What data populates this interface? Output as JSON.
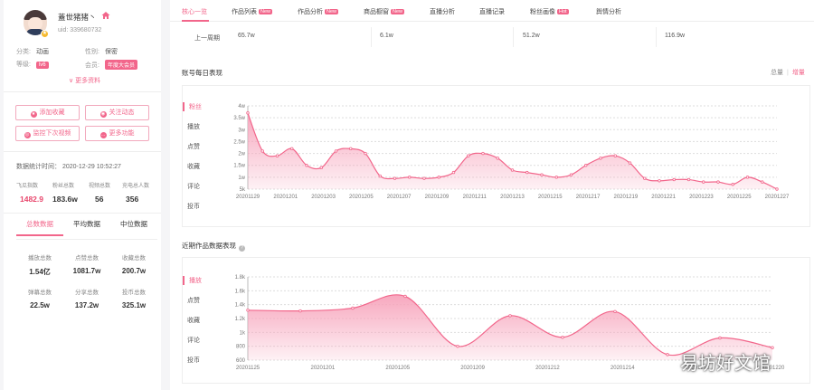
{
  "profile": {
    "name": "蓋世猪猪丶",
    "uid": "uid: 339680732",
    "category_label": "分类:",
    "category": "动画",
    "gender_label": "性别:",
    "gender": "保密",
    "level_label": "等级:",
    "level": "lv6",
    "member_label": "会员:",
    "member": "年度大会员",
    "vip_badge": "★",
    "more": "更多资料"
  },
  "actions": [
    {
      "label": "添加收藏",
      "icon": "★"
    },
    {
      "label": "关注动态",
      "icon": "◉"
    },
    {
      "label": "监控下次视频",
      "icon": "◎"
    },
    {
      "label": "更多功能",
      "icon": "…"
    }
  ],
  "stats_time": "数据统计时间：  2020-12-29 10:52:27",
  "summary": [
    {
      "label": "飞瓜指数",
      "value": "1482.9"
    },
    {
      "label": "粉丝总数",
      "value": "183.6w"
    },
    {
      "label": "视频总数",
      "value": "56"
    },
    {
      "label": "充电总人数",
      "value": "356"
    }
  ],
  "left_tabs": [
    "总数数据",
    "平均数据",
    "中位数据"
  ],
  "totals": [
    {
      "label": "播放总数",
      "value": "1.54亿"
    },
    {
      "label": "点赞总数",
      "value": "1081.7w"
    },
    {
      "label": "收藏总数",
      "value": "200.7w"
    },
    {
      "label": "弹幕总数",
      "value": "22.5w"
    },
    {
      "label": "分享总数",
      "value": "137.2w"
    },
    {
      "label": "投币总数",
      "value": "325.1w"
    }
  ],
  "nav": [
    {
      "label": "核心一览"
    },
    {
      "label": "作品列表",
      "badge": "New"
    },
    {
      "label": "作品分析",
      "badge": "New"
    },
    {
      "label": "商品橱窗",
      "badge": "New"
    },
    {
      "label": "直播分析"
    },
    {
      "label": "直播记录"
    },
    {
      "label": "粉丝画像",
      "badge": "Hot"
    },
    {
      "label": "舆情分析"
    }
  ],
  "prev_period": {
    "label": "上一周期",
    "values": [
      "65.7w",
      "6.1w",
      "51.2w",
      "116.9w"
    ]
  },
  "daily": {
    "title": "账号每日表现",
    "toggle_total": "总量",
    "toggle_inc": "增量",
    "metrics": [
      "粉丝",
      "播放",
      "点赞",
      "收藏",
      "评论",
      "投币"
    ]
  },
  "works": {
    "title": "近期作品数据表现",
    "metrics": [
      "播放",
      "点赞",
      "收藏",
      "评论",
      "投币"
    ]
  },
  "colors": {
    "accent": "#f2668b",
    "fill": "#f7a3bb"
  },
  "chart_data": [
    {
      "type": "area",
      "title": "账号每日表现",
      "series": [
        {
          "name": "粉丝",
          "values": [
            3.7,
            2.1,
            1.9,
            2.2,
            1.5,
            1.4,
            2.1,
            2.2,
            2.0,
            1.05,
            0.95,
            1.0,
            0.95,
            1.0,
            1.2,
            1.9,
            2.0,
            1.8,
            1.3,
            1.2,
            1.1,
            1.0,
            1.1,
            1.5,
            1.8,
            1.9,
            1.6,
            0.95,
            0.85,
            0.9,
            0.9,
            0.8,
            0.8,
            0.7,
            1.0,
            0.8,
            0.5
          ]
        }
      ],
      "x_tick_labels": [
        "20201129",
        "20201201",
        "20201203",
        "20201205",
        "20201207",
        "20201209",
        "20201211",
        "20201213",
        "20201215",
        "20201217",
        "20201219",
        "20201221",
        "20201223",
        "20201225",
        "20201227"
      ],
      "y_ticks": [
        "4w",
        "3.5w",
        "3w",
        "2.5w",
        "2w",
        "1.5w",
        "1w",
        "5k"
      ],
      "ylim": [
        0.5,
        4
      ]
    },
    {
      "type": "area",
      "title": "近期作品数据表现",
      "series": [
        {
          "name": "播放",
          "values": [
            1.32,
            1.31,
            1.35,
            1.52,
            0.8,
            1.24,
            0.93,
            1.3,
            0.68,
            0.92,
            0.78
          ]
        }
      ],
      "x": [
        "20201125",
        "20201201",
        "20201205",
        "20201209",
        "20201212",
        "20201214",
        "20201218",
        "20201220"
      ],
      "x_tick_labels": [
        "20201125",
        "20201201",
        "20201205",
        "20201209",
        "20201212",
        "20201214",
        "20201218",
        "20201220"
      ],
      "y_ticks": [
        "1.8k",
        "1.6k",
        "1.4k",
        "1.2k",
        "1k",
        "800",
        "600"
      ],
      "ylim": [
        0.6,
        1.8
      ]
    }
  ],
  "watermark": "易坊好文馆"
}
